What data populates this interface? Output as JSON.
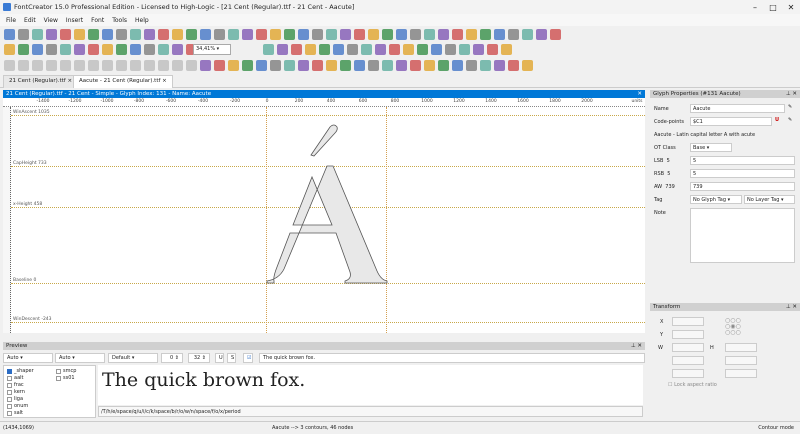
{
  "window": {
    "title": "FontCreator 15.0 Professional Edition - Licensed to High-Logic - [21 Cent (Regular).ttf - 21 Cent - Aacute]"
  },
  "menu": [
    "File",
    "Edit",
    "View",
    "Insert",
    "Font",
    "Tools",
    "Help"
  ],
  "toolbar": {
    "zoom": "34,41%"
  },
  "tabs": [
    {
      "label": "21 Cent (Regular).ttf"
    },
    {
      "label": "Aacute - 21 Cent (Regular).ttf"
    }
  ],
  "glyph_window": {
    "header": "21 Cent (Regular).ttf - 21 Cent - Simple - Glyph Index: 131 - Name: Aacute",
    "ruler": [
      "-1400",
      "-1200",
      "-1000",
      "-800",
      "-600",
      "-400",
      "-200",
      "0",
      "200",
      "400",
      "600",
      "800",
      "1000",
      "1200",
      "1400",
      "1600",
      "1800",
      "2000",
      "units"
    ],
    "guides": [
      {
        "label": "WinAscent 1035"
      },
      {
        "label": "CapHeight 733"
      },
      {
        "label": "x-Height 458"
      },
      {
        "label": "Baseline 0"
      },
      {
        "label": "WinDescent -243"
      }
    ],
    "glyph": "Á"
  },
  "preview": {
    "title": "Preview",
    "sel1": "Auto",
    "sel2": "Auto",
    "sel3": "Default",
    "spin1": "0",
    "spin2": "32",
    "text_input": "The quick brown fox.",
    "sample": "The quick brown fox.",
    "glyph_string": "/T/h/e/space/q/u/i/c/k/space/b/r/o/w/n/space/f/o/x/period",
    "features": [
      {
        "name": "_shaper",
        "checked": true
      },
      {
        "name": "aalt",
        "checked": false
      },
      {
        "name": "frac",
        "checked": false
      },
      {
        "name": "kern",
        "checked": false
      },
      {
        "name": "liga",
        "checked": false
      },
      {
        "name": "onum",
        "checked": false
      },
      {
        "name": "salt",
        "checked": false
      },
      {
        "name": "smcp",
        "checked": false
      },
      {
        "name": "ss01",
        "checked": false
      }
    ]
  },
  "glyph_properties": {
    "title": "Glyph Properties (#131 Aacute)",
    "name_label": "Name",
    "name": "Aacute",
    "cp_label": "Code-points",
    "cp": "$C1",
    "description": "Aacute - Latin capital letter A with acute",
    "ot_label": "OT Class",
    "ot": "Base",
    "lsb_label": "LSB",
    "lsb": "5",
    "lsb_val": "5",
    "rsb_label": "RSB",
    "rsb": "5",
    "rsb_val": "5",
    "aw_label": "AW",
    "aw": "739",
    "aw_val": "739",
    "tag_label": "Tag",
    "glyph_tag": "No Glyph Tag",
    "layer_tag": "No Layer Tag",
    "note_label": "Note"
  },
  "transform": {
    "title": "Transform",
    "x": "X",
    "y": "Y",
    "w": "W",
    "h": "H",
    "lock": "Lock aspect ratio"
  },
  "status": {
    "coords": "(1434,1069)",
    "info": "Aacute --> 3 contours, 46 nodes",
    "mode": "Contour mode"
  }
}
